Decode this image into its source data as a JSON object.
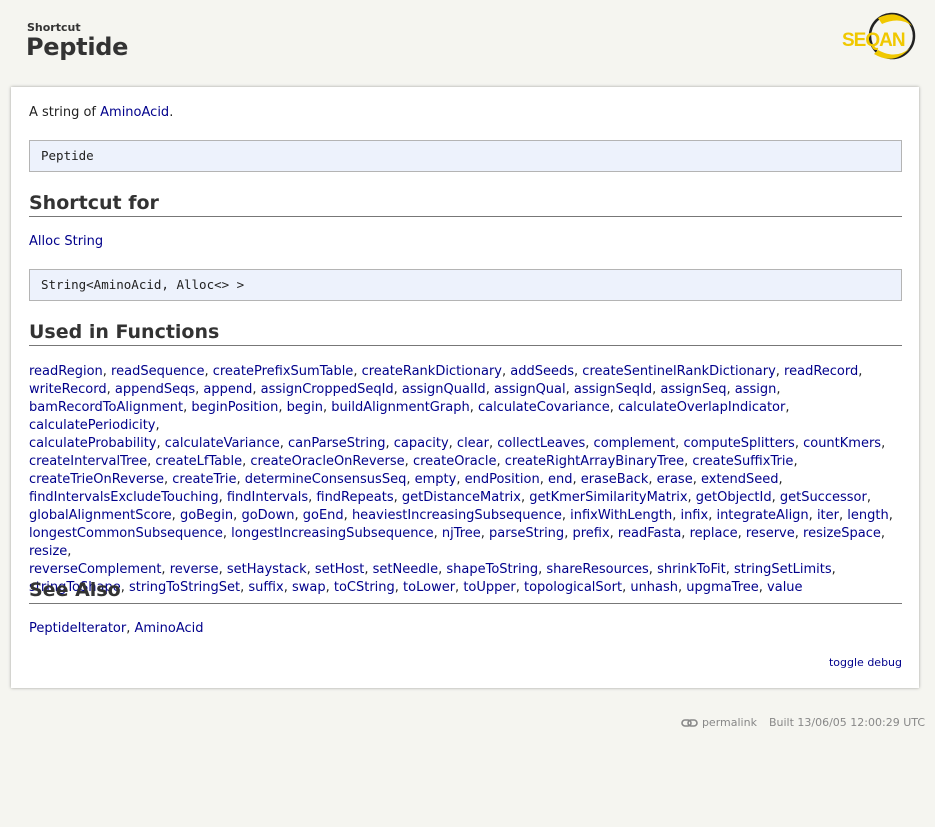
{
  "header": {
    "kind": "Shortcut",
    "title": "Peptide",
    "logo_text": "SEQAN"
  },
  "intro": {
    "prefix": "A string of ",
    "link": "AminoAcid",
    "suffix": "."
  },
  "signature": "Peptide",
  "shortcut_for": {
    "heading": "Shortcut for",
    "link": "Alloc String",
    "code": "String<AminoAcid, Alloc<> >"
  },
  "used_in_functions": {
    "heading": "Used in Functions",
    "lines": [
      [
        "readRegion",
        "readSequence",
        "createPrefixSumTable",
        "createRankDictionary",
        "addSeeds",
        "createSentinelRankDictionary",
        "readRecord"
      ],
      [
        "writeRecord",
        "appendSeqs",
        "append",
        "assignCroppedSeqId",
        "assignQualId",
        "assignQual",
        "assignSeqId",
        "assignSeq",
        "assign"
      ],
      [
        "bamRecordToAlignment",
        "beginPosition",
        "begin",
        "buildAlignmentGraph",
        "calculateCovariance",
        "calculateOverlapIndicator",
        "calculatePeriodicity"
      ],
      [
        "calculateProbability",
        "calculateVariance",
        "canParseString",
        "capacity",
        "clear",
        "collectLeaves",
        "complement",
        "computeSplitters",
        "countKmers"
      ],
      [
        "createIntervalTree",
        "createLfTable",
        "createOracleOnReverse",
        "createOracle",
        "createRightArrayBinaryTree",
        "createSuffixTrie"
      ],
      [
        "createTrieOnReverse",
        "createTrie",
        "determineConsensusSeq",
        "empty",
        "endPosition",
        "end",
        "eraseBack",
        "erase",
        "extendSeed"
      ],
      [
        "findIntervalsExcludeTouching",
        "findIntervals",
        "findRepeats",
        "getDistanceMatrix",
        "getKmerSimilarityMatrix",
        "getObjectId",
        "getSuccessor"
      ],
      [
        "globalAlignmentScore",
        "goBegin",
        "goDown",
        "goEnd",
        "heaviestIncreasingSubsequence",
        "infixWithLength",
        "infix",
        "integrateAlign",
        "iter",
        "length"
      ],
      [
        "longestCommonSubsequence",
        "longestIncreasingSubsequence",
        "njTree",
        "parseString",
        "prefix",
        "readFasta",
        "replace",
        "reserve",
        "resizeSpace",
        "resize"
      ],
      [
        "reverseComplement",
        "reverse",
        "setHaystack",
        "setHost",
        "setNeedle",
        "shapeToString",
        "shareResources",
        "shrinkToFit",
        "stringSetLimits"
      ],
      [
        "stringToShape",
        "stringToStringSet",
        "suffix",
        "swap",
        "toCString",
        "toLower",
        "toUpper",
        "topologicalSort",
        "unhash",
        "upgmaTree",
        "value"
      ]
    ]
  },
  "see_also": {
    "heading": "See Also",
    "links": [
      "PeptideIterator",
      "AminoAcid"
    ]
  },
  "toggle_debug": "toggle debug",
  "footer": {
    "permalink": "permalink",
    "built": "Built 13/06/05 12:00:29 UTC"
  },
  "colors": {
    "link": "#00008b",
    "code_bg": "#edf2fc",
    "page_bg": "#f5f5f0",
    "logo_yellow": "#f0c800"
  },
  "icons": [
    "seqan-logo",
    "chain-link-icon"
  ]
}
